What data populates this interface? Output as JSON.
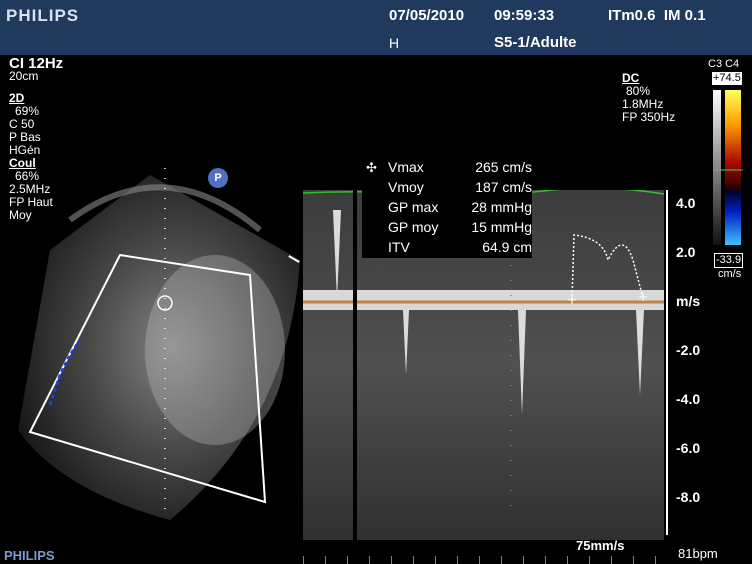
{
  "header": {
    "brand": "PHILIPS",
    "date": "07/05/2010",
    "time": "09:59:33",
    "indices": "ITm0.6  IM 0.1",
    "probe_preset": "S5-1/Adulte",
    "marker": "H"
  },
  "left_params": {
    "mode_label": "CI 12Hz",
    "depth": "20cm",
    "twoD": {
      "title": "2D",
      "lines": [
        "69%",
        "C 50",
        "P Bas",
        "HGén"
      ]
    },
    "color": {
      "title": "Coul",
      "lines": [
        "66%",
        "2.5MHz",
        "FP Haut",
        "Moy"
      ]
    }
  },
  "right_params": {
    "title": "DC",
    "lines": [
      "80%",
      "1.8MHz",
      "FP 350Hz"
    ]
  },
  "colorbar": {
    "labels_top": "C3 C4",
    "max": "+74.5",
    "min": "-33.9",
    "unit": "cm/s"
  },
  "probe_icon": "P",
  "measurements": [
    {
      "label": "Vmax",
      "value": "265 cm/s"
    },
    {
      "label": "Vmoy",
      "value": "187 cm/s"
    },
    {
      "label": "GP max",
      "value": "28 mmHg"
    },
    {
      "label": "GP moy",
      "value": "15 mmHg"
    },
    {
      "label": "ITV",
      "value": "64.9 cm"
    }
  ],
  "axis": {
    "unit": "m/s",
    "ticks": [
      "4.0",
      "2.0",
      "-2.0",
      "-4.0",
      "-6.0",
      "-8.0"
    ]
  },
  "sweep_speed": "75mm/s",
  "heart_rate": "81bpm",
  "footer_brand": "PHILIPS"
}
